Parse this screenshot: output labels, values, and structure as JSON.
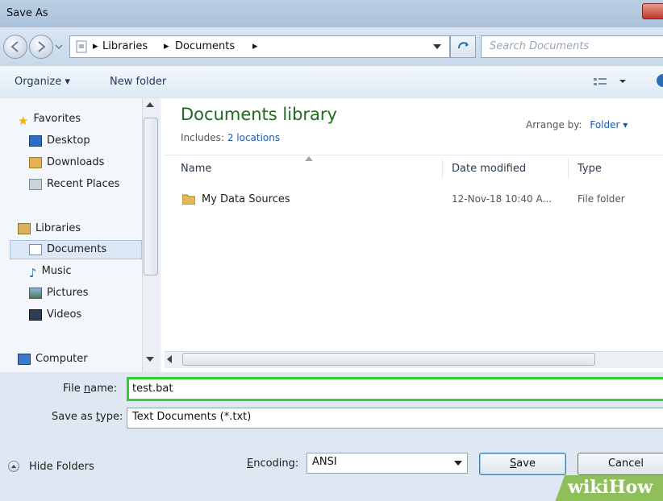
{
  "window": {
    "title": "Save As"
  },
  "address": {
    "crumbs": [
      "Libraries",
      "Documents"
    ],
    "search_placeholder": "Search Documents"
  },
  "toolbar": {
    "organize": "Organize ▾",
    "new_folder": "New folder"
  },
  "nav": {
    "favorites": "Favorites",
    "desktop": "Desktop",
    "downloads": "Downloads",
    "recent": "Recent Places",
    "libraries": "Libraries",
    "documents": "Documents",
    "music": "Music",
    "pictures": "Pictures",
    "videos": "Videos",
    "computer": "Computer"
  },
  "library": {
    "title": "Documents library",
    "includes_label": "Includes:",
    "includes_value": "2 locations",
    "arrange_label": "Arrange by:",
    "arrange_value": "Folder ▾"
  },
  "columns": {
    "name": "Name",
    "date": "Date modified",
    "type": "Type"
  },
  "files": [
    {
      "name": "My Data Sources",
      "date": "12-Nov-18 10:40 A...",
      "type": "File folder"
    }
  ],
  "form": {
    "filename_label_pre": "File ",
    "filename_label_u": "n",
    "filename_label_post": "ame:",
    "filename_value": "test.bat",
    "savetype_label_pre": "Save as ",
    "savetype_label_u": "t",
    "savetype_label_post": "ype:",
    "savetype_value": "Text Documents (*.txt)",
    "hide_folders": "Hide Folders",
    "encoding_label_u": "E",
    "encoding_label_post": "ncoding:",
    "encoding_value": "ANSI",
    "save_u": "S",
    "save_post": "ave",
    "cancel": "Cancel"
  },
  "watermark": {
    "text": "wikiHow"
  },
  "colors": {
    "accent": "#1a5bb8",
    "library_title": "#1e6b1e",
    "highlight": "#2fcf2f"
  }
}
